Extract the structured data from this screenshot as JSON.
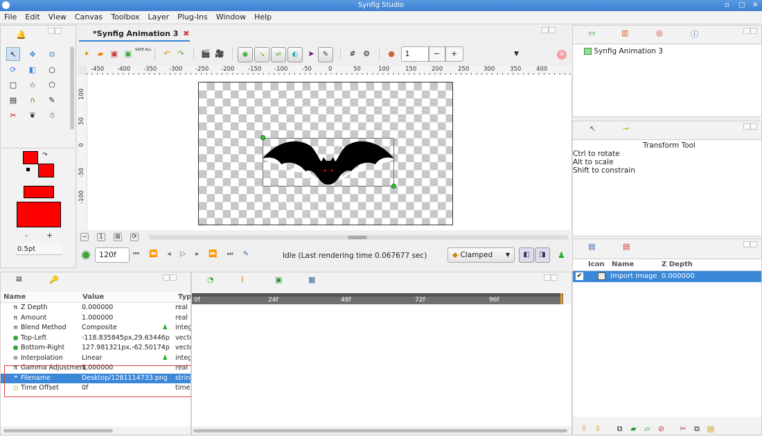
{
  "window": {
    "title": "Synfig Studio"
  },
  "menu": [
    "File",
    "Edit",
    "View",
    "Canvas",
    "Toolbox",
    "Layer",
    "Plug-Ins",
    "Window",
    "Help"
  ],
  "canvas_tab": {
    "title": "*Synfig Animation 3"
  },
  "toolbar": {
    "save_all": "SAVE ALL",
    "zoom_value": "1",
    "minus": "−",
    "plus": "+"
  },
  "ruler": {
    "h": [
      "-450",
      "-400",
      "-350",
      "-300",
      "-250",
      "-200",
      "-150",
      "-100",
      "-50",
      "0",
      "50",
      "100",
      "150",
      "200",
      "250",
      "300",
      "350",
      "400"
    ],
    "v": [
      "100",
      "50",
      "0",
      "-50",
      "-100"
    ]
  },
  "width_panel": {
    "minus": "-",
    "plus": "+",
    "width": "0.5pt"
  },
  "colors": {
    "outline": "#ff0000",
    "fill": "#ff0000",
    "accent": "#3b87d8",
    "bat": "#000000"
  },
  "timebar": {
    "frame": "120f",
    "status": "Idle (Last rendering time 0.067677 sec)",
    "interp": "Clamped"
  },
  "canvas_browser": {
    "item": "Synfig Animation 3"
  },
  "tool_options": {
    "title": "Transform Tool",
    "lines": [
      "Ctrl to rotate",
      "Alt to scale",
      "Shift to constrain"
    ]
  },
  "layers": {
    "headers": [
      "Icon",
      "Name",
      "Z Depth"
    ],
    "rows": [
      {
        "name": "Import Image",
        "zdepth": "0.000000"
      }
    ]
  },
  "params": {
    "headers": [
      "Name",
      "Value",
      "Typ"
    ],
    "rows": [
      {
        "icon": "π",
        "name": "Z Depth",
        "value": "0.000000",
        "type": "real"
      },
      {
        "icon": "π",
        "name": "Amount",
        "value": "1.000000",
        "type": "real"
      },
      {
        "icon": "≡",
        "name": "Blend Method",
        "value": "Composite",
        "type": "intege"
      },
      {
        "icon": "●",
        "name": "Top-Left",
        "value": "-118.835845px,29.63446p",
        "type": "vecto"
      },
      {
        "icon": "●",
        "name": "Bottom-Right",
        "value": "127.981321px,-62.50174p",
        "type": "vecto"
      },
      {
        "icon": "≡",
        "name": "Interpolation",
        "value": "Linear",
        "type": "intege"
      },
      {
        "icon": "π",
        "name": "Gamma Adjustment",
        "value": "1.000000",
        "type": "real"
      },
      {
        "icon": "❝",
        "name": "Filename",
        "value": "Desktop/1281114733.png",
        "type": "string"
      },
      {
        "icon": "◷",
        "name": "Time Offset",
        "value": "0f",
        "type": "time"
      }
    ]
  },
  "timetrack": {
    "ticks": [
      "0f",
      "24f",
      "48f",
      "72f",
      "96f"
    ]
  }
}
